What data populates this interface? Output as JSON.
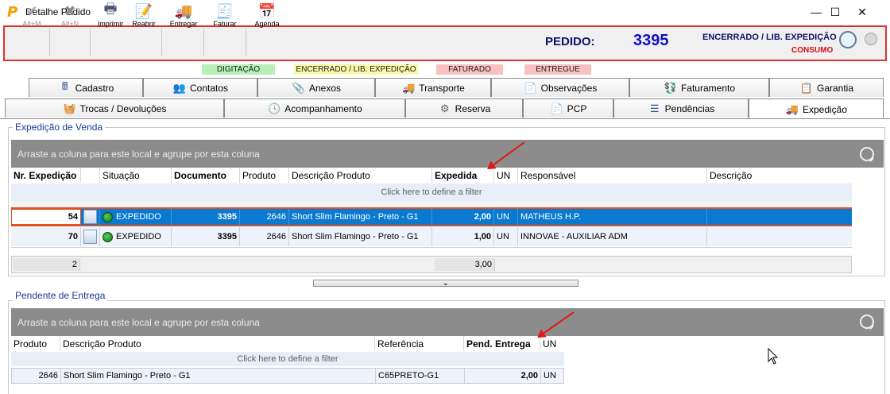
{
  "window": {
    "title": "Detalhe Pedido",
    "logo": "P",
    "min_glyph": "—",
    "max_glyph": "☐",
    "close_glyph": "✕"
  },
  "toolbar": {
    "buttons": [
      {
        "label": "Alt+M",
        "icon": "check-icon",
        "glyph": "✔"
      },
      {
        "label": "Alt+N",
        "icon": "x-icon",
        "glyph": "✖"
      },
      {
        "label": "Imprimir",
        "icon": "printer-icon",
        "glyph": "🖶"
      },
      {
        "label": "Reabrir",
        "icon": "notepad-icon",
        "glyph": "📝"
      },
      {
        "label": "Entregar",
        "icon": "truck-icon",
        "glyph": "🚚"
      },
      {
        "label": "Faturar",
        "icon": "invoice-icon",
        "glyph": "🧾"
      },
      {
        "label": "Agenda",
        "icon": "calendar-icon",
        "glyph": "📅"
      }
    ],
    "pedido_label": "PEDIDO:",
    "pedido_number": "3395",
    "status": "ENCERRADO / LIB. EXPEDIÇÃO",
    "status_sub": "CONSUMO"
  },
  "stages": [
    {
      "label": "DIGITAÇÃO",
      "color": "#b8f0b8"
    },
    {
      "label": "ENCERRADO / LIB. EXPEDIÇÃO",
      "color": "#f8f8a8"
    },
    {
      "label": "FATURADO",
      "color": "#f8c0c0"
    },
    {
      "label": "ENTREGUE",
      "color": "#f8c0c0"
    }
  ],
  "tabs_row1": [
    {
      "label": "Cadastro",
      "icon": "register-icon",
      "glyph": "🖩"
    },
    {
      "label": "Contatos",
      "icon": "contacts-icon",
      "glyph": "👥"
    },
    {
      "label": "Anexos",
      "icon": "paperclip-icon",
      "glyph": "📎"
    },
    {
      "label": "Transporte",
      "icon": "truck-icon",
      "glyph": "🚚"
    },
    {
      "label": "Observações",
      "icon": "notes-icon",
      "glyph": "📄"
    },
    {
      "label": "Faturamento",
      "icon": "billing-icon",
      "glyph": "💱"
    },
    {
      "label": "Garantia",
      "icon": "clipboard-check-icon",
      "glyph": "📋"
    }
  ],
  "tabs_row2": [
    {
      "label": "Trocas / Devoluções",
      "icon": "basket-icon",
      "glyph": "🧺"
    },
    {
      "label": "Acompanhamento",
      "icon": "clock-icon",
      "glyph": "🕓"
    },
    {
      "label": "Reserva",
      "icon": "gears-icon",
      "glyph": "⚙"
    },
    {
      "label": "PCP",
      "icon": "document-icon",
      "glyph": "📄"
    },
    {
      "label": "Pendências",
      "icon": "list-icon",
      "glyph": "☰"
    },
    {
      "label": "Expedição",
      "icon": "truck-icon",
      "glyph": "🚚"
    }
  ],
  "expedicao": {
    "section_title": "Expedição de Venda",
    "group_hint": "Arraste a coluna para este local e agrupe por esta coluna",
    "columns": [
      "Nr. Expedição",
      "Situação",
      "Documento",
      "Produto",
      "Descrição Produto",
      "Expedida",
      "UN",
      "Responsável",
      "Descrição"
    ],
    "filter_hint": "Click here to define a filter",
    "rows": [
      {
        "nr": "54",
        "situacao": "EXPEDIDO",
        "documento": "3395",
        "produto": "2646",
        "descricao": "Short Slim Flamingo - Preto - G1",
        "expedida": "2,00",
        "un": "UN",
        "responsavel": "MATHEUS H.P.",
        "desc": ""
      },
      {
        "nr": "70",
        "situacao": "EXPEDIDO",
        "documento": "3395",
        "produto": "2646",
        "descricao": "Short Slim Flamingo - Preto - G1",
        "expedida": "1,00",
        "un": "UN",
        "responsavel": "INNOVAE - AUXILIAR ADM",
        "desc": ""
      }
    ],
    "footer_count": "2",
    "footer_total": "3,00"
  },
  "pendente": {
    "section_title": "Pendente de Entrega",
    "group_hint": "Arraste a coluna para este local e agrupe por esta coluna",
    "columns": [
      "Produto",
      "Descrição Produto",
      "Referência",
      "Pend. Entrega",
      "UN"
    ],
    "filter_hint": "Click here to define a filter",
    "rows": [
      {
        "produto": "2646",
        "descricao": "Short Slim Flamingo - Preto - G1",
        "referencia": "C65PRETO-G1",
        "pend": "2,00",
        "un": "UN"
      }
    ]
  },
  "splitter_glyph": "⌄"
}
